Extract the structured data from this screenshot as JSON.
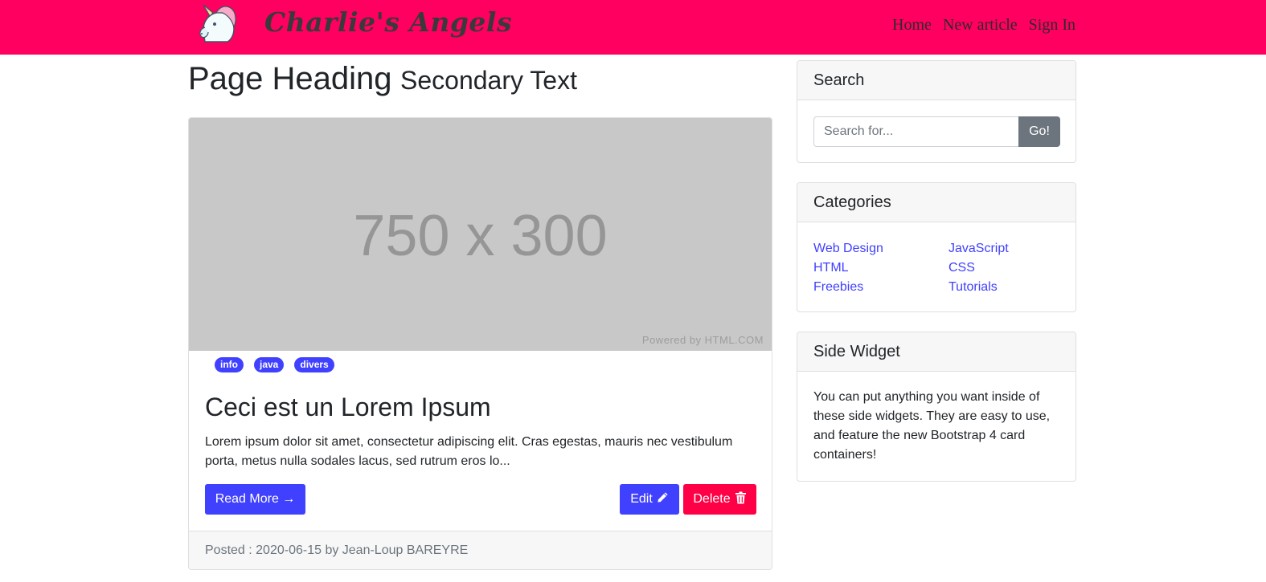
{
  "navbar": {
    "brand": "Charlie's Angels",
    "logo_icon": "unicorn-icon",
    "links": [
      {
        "label": "Home"
      },
      {
        "label": "New article"
      },
      {
        "label": "Sign In"
      }
    ],
    "bg_color": "#ff0060"
  },
  "heading": {
    "main": "Page Heading",
    "secondary": "Secondary Text"
  },
  "post": {
    "image_placeholder": "750 x 300",
    "image_credit": "Powered by HTML.COM",
    "tags": [
      "info",
      "java",
      "divers"
    ],
    "title": "Ceci est un Lorem Ipsum",
    "excerpt": "Lorem ipsum dolor sit amet, consectetur adipiscing elit. Cras egestas, mauris nec vestibulum porta, metus nulla sodales lacus, sed rutrum eros lo...",
    "read_more_label": "Read More →",
    "edit_label": "Edit",
    "edit_icon": "pencil-icon",
    "delete_label": "Delete",
    "delete_icon": "trash-icon",
    "footer": "Posted : 2020-06-15 by Jean-Loup BAREYRE"
  },
  "sidebar": {
    "search": {
      "title": "Search",
      "placeholder": "Search for...",
      "button_label": "Go!"
    },
    "categories": {
      "title": "Categories",
      "items": [
        "Web Design",
        "JavaScript",
        "HTML",
        "CSS",
        "Freebies",
        "Tutorials"
      ]
    },
    "widget": {
      "title": "Side Widget",
      "text": "You can put anything you want inside of these side widgets. They are easy to use, and feature the new Bootstrap 4 card containers!"
    }
  },
  "colors": {
    "primary": "#4040ff",
    "danger": "#ff0046",
    "secondary": "#6c757d"
  }
}
